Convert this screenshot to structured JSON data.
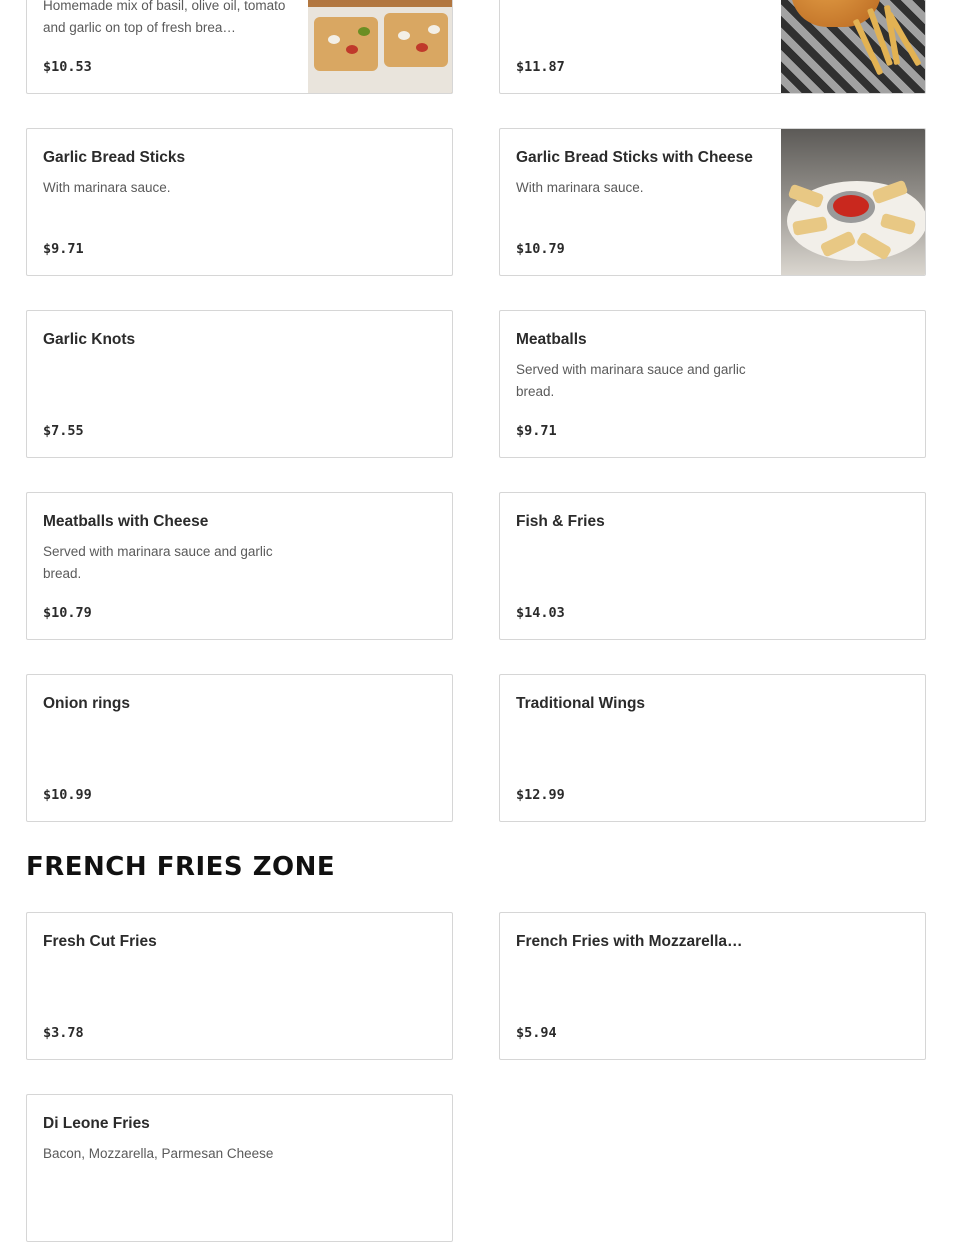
{
  "menu_items": [
    {
      "name": "",
      "description": "Homemade mix of basil, olive oil, tomato and garlic on top of fresh brea…",
      "price": "$10.53",
      "image": "bruschetta-image"
    },
    {
      "name": "",
      "description": "",
      "price": "$11.87",
      "image": "fish-and-fries-image"
    },
    {
      "name": "Garlic Bread Sticks",
      "description": "With marinara sauce.",
      "price": "$9.71"
    },
    {
      "name": "Garlic Bread Sticks with Cheese",
      "description": "With marinara sauce.",
      "price": "$10.79",
      "image": "garlic-bread-sticks-image"
    },
    {
      "name": "Garlic Knots",
      "description": "",
      "price": "$7.55"
    },
    {
      "name": "Meatballs",
      "description": "Served with marinara sauce and garlic bread.",
      "price": "$9.71"
    },
    {
      "name": "Meatballs with Cheese",
      "description": "Served with marinara sauce and garlic bread.",
      "price": "$10.79"
    },
    {
      "name": "Fish & Fries",
      "description": "",
      "price": "$14.03"
    },
    {
      "name": "Onion rings",
      "description": "",
      "price": "$10.99"
    },
    {
      "name": "Traditional Wings",
      "description": "",
      "price": "$12.99"
    }
  ],
  "section": {
    "title": "FRENCH FRIES ZONE",
    "items": [
      {
        "name": "Fresh Cut Fries",
        "description": "",
        "price": "$3.78"
      },
      {
        "name": "French Fries with Mozzarella…",
        "description": "",
        "price": "$5.94"
      },
      {
        "name": "Di Leone Fries",
        "description": "Bacon, Mozzarella, Parmesan Cheese",
        "price": ""
      }
    ]
  }
}
